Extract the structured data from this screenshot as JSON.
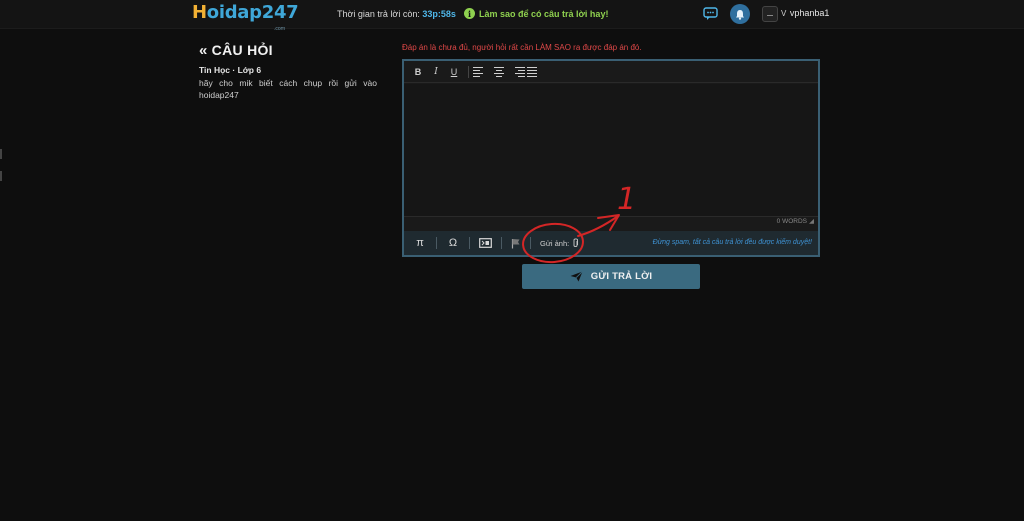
{
  "header": {
    "logo_h": "H",
    "logo_rest": "oidap247",
    "logo_sub": ".com",
    "timer_label": "Thời gian trả lời còn:",
    "timer_value": "33p:58s",
    "tip_icon": "i",
    "tip_text": "Làm sao để có câu trả lời hay!",
    "icons": {
      "chat": "chat-icon",
      "bell": "bell-icon"
    },
    "user_badge": "V",
    "username": "vphanba1"
  },
  "question": {
    "back_glyph": "«",
    "title": "CÂU HỎI",
    "subject": "Tin Học · Lớp 6",
    "text": "hãy cho mik biết cách chụp rồi gửi vào hoidap247"
  },
  "answer": {
    "warning": "Đáp án là chưa đủ, người hỏi rất cần LÀM SAO ra được đáp án đó.",
    "toolbar": [
      "B",
      "I",
      "U"
    ],
    "word_count": "0 WORDS",
    "bottom_icons": [
      "π",
      "Ω"
    ],
    "send_image_label": "Gửi ảnh:",
    "spam_notice": "Đừng spam, tất cả câu trả lời đều được kiểm duyệt!",
    "submit_label": "GỬI TRẢ LỜI"
  },
  "annotation": {
    "number": "1",
    "color": "#d42626"
  },
  "colors": {
    "accent": "#3fa7d8",
    "logo_yellow": "#f2b134",
    "warning": "#e04848",
    "tip": "#8fd14f",
    "button": "#3a6a80"
  }
}
